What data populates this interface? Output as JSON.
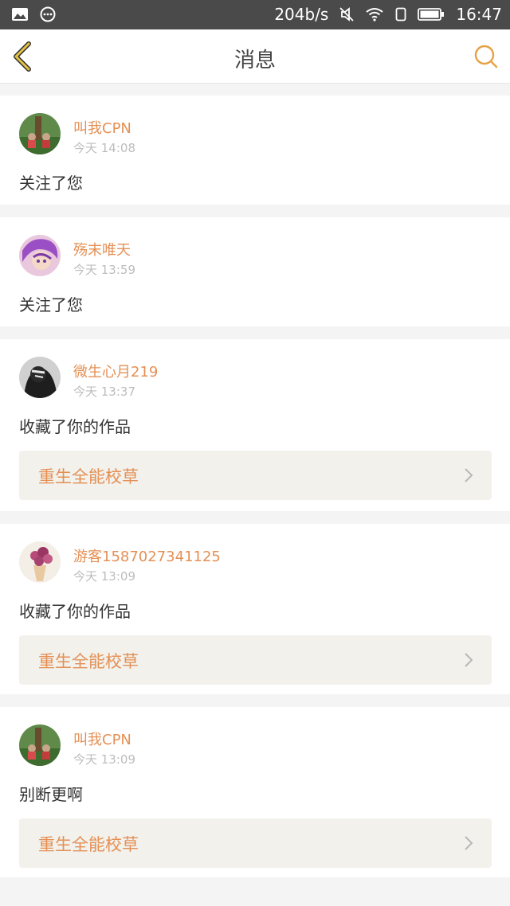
{
  "status_bar": {
    "speed": "204b/s",
    "time": "16:47",
    "icons": [
      "image-icon",
      "chat-bubble-icon",
      "mute-icon",
      "wifi-icon",
      "sim-icon",
      "battery-icon"
    ]
  },
  "header": {
    "title": "消息",
    "back_icon": "chevron-left-icon",
    "search_icon": "search-icon",
    "accent_color": "#e4a244"
  },
  "messages": [
    {
      "user": "叫我CPN",
      "time": "今天 14:08",
      "text": "关注了您",
      "work": null
    },
    {
      "user": "殇末唯天",
      "time": "今天 13:59",
      "text": "关注了您",
      "work": null
    },
    {
      "user": "微生心月219",
      "time": "今天 13:37",
      "text": "收藏了你的作品",
      "work": "重生全能校草"
    },
    {
      "user": "游客1587027341125",
      "time": "今天 13:09",
      "text": "收藏了你的作品",
      "work": "重生全能校草"
    },
    {
      "user": "叫我CPN",
      "time": "今天 13:09",
      "text": "别断更啊",
      "work": "重生全能校草"
    }
  ],
  "colors": {
    "username": "#e49055",
    "work_bg": "#f2f1ec",
    "time": "#bdbdbd"
  }
}
